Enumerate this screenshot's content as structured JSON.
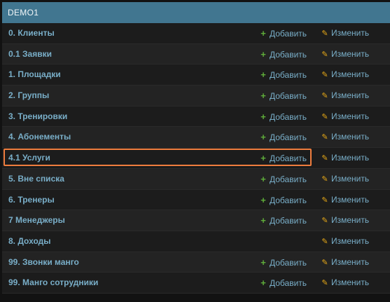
{
  "caption": "DEMO1",
  "add_label": "Добавить",
  "change_label": "Изменить",
  "rows": [
    {
      "name": "0. Клиенты",
      "has_add": true
    },
    {
      "name": "0.1 Заявки",
      "has_add": true
    },
    {
      "name": "1. Площадки",
      "has_add": true
    },
    {
      "name": "2. Группы",
      "has_add": true
    },
    {
      "name": "3. Тренировки",
      "has_add": true
    },
    {
      "name": "4. Абонементы",
      "has_add": true
    },
    {
      "name": "4.1 Услуги",
      "has_add": true,
      "highlighted": true
    },
    {
      "name": "5. Вне списка",
      "has_add": true
    },
    {
      "name": "6. Тренеры",
      "has_add": true
    },
    {
      "name": "7 Менеджеры",
      "has_add": true
    },
    {
      "name": "8. Доходы",
      "has_add": false
    },
    {
      "name": "99. Звонки манго",
      "has_add": true
    },
    {
      "name": "99. Манго сотрудники",
      "has_add": true
    }
  ],
  "colors": {
    "caption_bg": "#417690",
    "link": "#79aec8",
    "add_icon": "#5fae3a",
    "change_icon": "#e6a817",
    "highlight_border": "#ef7d3e"
  },
  "icons": {
    "add": "plus-icon",
    "change": "pencil-icon"
  }
}
